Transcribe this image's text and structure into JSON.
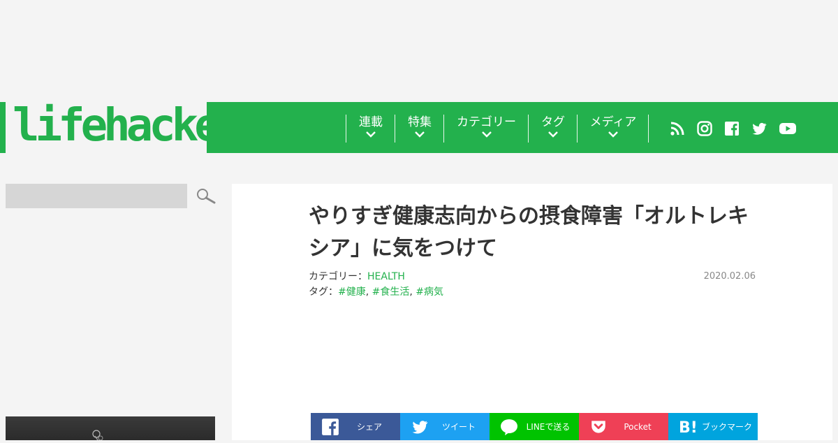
{
  "brand": {
    "logo_text": "lifehacker",
    "accent": "#23b14d"
  },
  "nav": {
    "items": [
      {
        "label": "連載"
      },
      {
        "label": "特集"
      },
      {
        "label": "カテゴリー"
      },
      {
        "label": "タグ"
      },
      {
        "label": "メディア"
      }
    ],
    "social_icons": [
      "rss-icon",
      "instagram-icon",
      "facebook-icon",
      "twitter-icon",
      "youtube-icon"
    ]
  },
  "sidebar": {
    "search": {
      "value": "",
      "placeholder": ""
    }
  },
  "article": {
    "title": "やりすぎ健康志向からの摂食障害「オルトレキシア」に気をつけて",
    "category_label": "カテゴリー：",
    "category": "HEALTH",
    "tags_label": "タグ：",
    "tags": [
      "#健康",
      "#食生活",
      "#病気"
    ],
    "tag_sep": ",",
    "date": "2020.02.06"
  },
  "share": [
    {
      "label": "シェア",
      "color": "#3b5998",
      "icon": "facebook-icon"
    },
    {
      "label": "ツイート",
      "color": "#1da1f2",
      "icon": "twitter-icon"
    },
    {
      "label": "LINEで送る",
      "color": "#00c300",
      "icon": "line-icon"
    },
    {
      "label": "Pocket",
      "color": "#ef4056",
      "icon": "pocket-icon"
    },
    {
      "label": "ブックマーク",
      "color": "#00a4de",
      "icon": "hatena-bookmark-icon"
    }
  ]
}
